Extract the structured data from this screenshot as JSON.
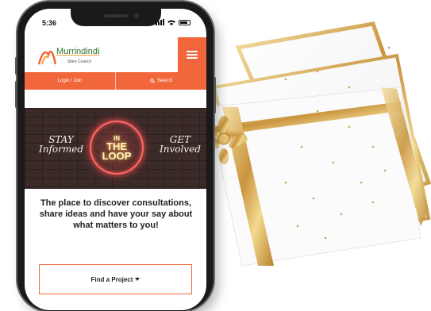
{
  "status_bar": {
    "time": "5:36"
  },
  "site": {
    "logo_name": "Murrindindi",
    "logo_sub": "Shire Council",
    "nav": [
      {
        "label": "Login / Join"
      },
      {
        "label": "Search"
      }
    ]
  },
  "hero": {
    "left_text_1": "STAY",
    "left_text_2": "Informed",
    "center_1": "IN",
    "center_2": "THE",
    "center_3": "LOOP",
    "right_text_1": "GET",
    "right_text_2": "Involved"
  },
  "main": {
    "tagline": "The place to discover consultations, share ideas and have your say about what matters to you!",
    "find_button": "Find a Project"
  },
  "colors": {
    "accent": "#f2663b",
    "logo_green": "#2a6f2b",
    "ribbon_gold": "#d9b56a"
  },
  "icons": {
    "menu": "hamburger-icon",
    "search": "search-icon",
    "dropdown": "caret-down-icon",
    "bow": "gift-bow-icon"
  }
}
